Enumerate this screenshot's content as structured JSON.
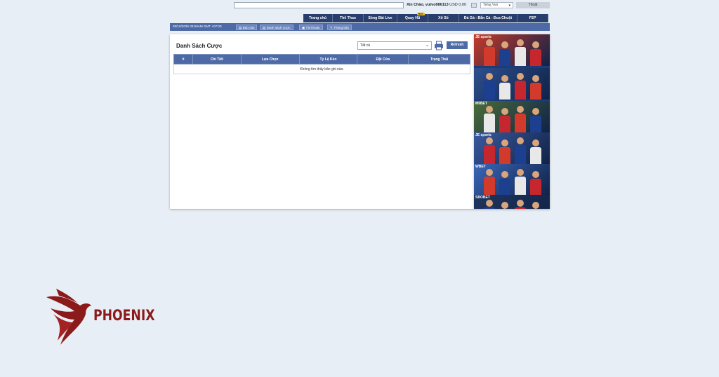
{
  "topbar": {
    "greeting": "Xin Chào,",
    "username": "vutvo086113",
    "balance": "USD 0.00",
    "language": "Tiếng Việt",
    "logout_label": "Thoát"
  },
  "mainnav": [
    {
      "label": "Trang chủ",
      "width": 42
    },
    {
      "label": "Thể Thao",
      "width": 44
    },
    {
      "label": "Sòng Bài Live",
      "width": 48
    },
    {
      "label": "Quay Hũ",
      "width": 44,
      "badge": "HOT"
    },
    {
      "label": "Xổ Số",
      "width": 44
    },
    {
      "label": "Đá Gà - Bắn Cá - Đua Chuột",
      "width": 83
    },
    {
      "label": "P2P",
      "width": 44
    }
  ],
  "subnav": {
    "time": "03/10/2025 05:50AM GMT +07:00",
    "buttons": [
      {
        "label": "Báo cáo",
        "icon": "report-icon"
      },
      {
        "label": "Danh sách cược",
        "icon": "list-icon"
      },
      {
        "label": "Tài khoản",
        "icon": "account-icon"
      },
      {
        "label": "Thông báo",
        "icon": "bell-icon"
      }
    ]
  },
  "panel": {
    "title": "Danh Sách Cược",
    "filter_value": "Tất cả",
    "refresh_label": "Refresh",
    "columns": [
      "#",
      "Chi Tiết",
      "Lựa Chọn",
      "Tỷ Lệ Kèo",
      "Đặt Cửa",
      "Trạng Thái"
    ],
    "empty_message": "Không tìm thấy bản ghi nào."
  },
  "banners": [
    {
      "label": "JE sports",
      "bg": "#c43a2a"
    },
    {
      "label": "",
      "bg": "#2d4f8f"
    },
    {
      "label": "M9BET",
      "bg": "#4a6d3a"
    },
    {
      "label": "JE sports",
      "bg": "#3a5aa0"
    },
    {
      "label": "WBET",
      "bg": "#3b66b8"
    },
    {
      "label": "SBOBET",
      "bg": "#20355f"
    }
  ],
  "logo": {
    "text": "PHOENIX",
    "color": "#8b1a1a"
  }
}
